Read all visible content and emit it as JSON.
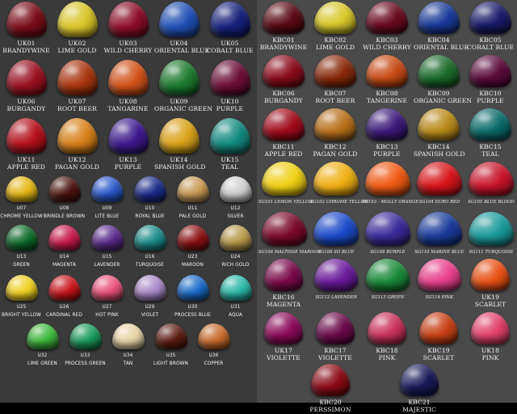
{
  "left_panel": {
    "big_rows": [
      [
        {
          "code": "UK01",
          "name": "BRANDYWINE",
          "color": "#7a0c18"
        },
        {
          "code": "UK02",
          "name": "LIME GOLD",
          "color": "#d9c52a"
        },
        {
          "code": "UK03",
          "name": "WILD CHERRY",
          "color": "#8c0d2a"
        },
        {
          "code": "UK04",
          "name": "ORIENTAL BLUE",
          "color": "#1f4fb3"
        },
        {
          "code": "UK05",
          "name": "COBALT BLUE",
          "color": "#15207a"
        }
      ],
      [
        {
          "code": "UK06",
          "name": "BURGANDY",
          "color": "#9a1020"
        },
        {
          "code": "UK07",
          "name": "ROOT BEER",
          "color": "#a8350f"
        },
        {
          "code": "UK08",
          "name": "TANGARINE",
          "color": "#d2521a"
        },
        {
          "code": "UK09",
          "name": "ORGANIC GREEN",
          "color": "#1c7a2e"
        },
        {
          "code": "UK10",
          "name": "PURPLE",
          "color": "#6a0e35"
        }
      ],
      [
        {
          "code": "UK11",
          "name": "APPLE RED",
          "color": "#b5101c"
        },
        {
          "code": "UK12",
          "name": "PAGAN GOLD",
          "color": "#d7811a"
        },
        {
          "code": "UK13",
          "name": "PURPLE",
          "color": "#3c1a8e"
        },
        {
          "code": "UK14",
          "name": "SPANISH GOLD",
          "color": "#d9a21a"
        },
        {
          "code": "UK15",
          "name": "TEAL",
          "color": "#138a80"
        }
      ]
    ],
    "small_rows": [
      [
        {
          "code": "U07",
          "name": "CHROME YELLOW",
          "color": "#e6b814"
        },
        {
          "code": "U08",
          "name": "BRINDLE BROWN",
          "color": "#4a1410"
        },
        {
          "code": "U09",
          "name": "LITE BLUE",
          "color": "#2a56c8"
        },
        {
          "code": "U10",
          "name": "ROYAL BLUE",
          "color": "#1a2a8a"
        },
        {
          "code": "U11",
          "name": "PALE GOLD",
          "color": "#c89a55"
        },
        {
          "code": "U12",
          "name": "SILVER",
          "color": "#cfcfcf"
        }
      ],
      [
        {
          "code": "U13",
          "name": "GREEN",
          "color": "#0e6a2a"
        },
        {
          "code": "U14",
          "name": "MAGENTA",
          "color": "#c8184a"
        },
        {
          "code": "U15",
          "name": "LAVENDER",
          "color": "#5a2a8a"
        },
        {
          "code": "U16",
          "name": "TURQUOISE",
          "color": "#1a8a8a"
        },
        {
          "code": "U23",
          "name": "MAROON",
          "color": "#8a1010"
        },
        {
          "code": "U24",
          "name": "RICH GOLD",
          "color": "#b89a4a"
        }
      ],
      [
        {
          "code": "U25",
          "name": "BRIGHT YELLOW",
          "color": "#f0d020"
        },
        {
          "code": "U26",
          "name": "CARDINAL RED",
          "color": "#c8141a"
        },
        {
          "code": "U27",
          "name": "HOT PINK",
          "color": "#e8507a"
        },
        {
          "code": "U29",
          "name": "VIOLET",
          "color": "#a88ac8"
        },
        {
          "code": "U30",
          "name": "PROCESS BLUE",
          "color": "#1a6ac8"
        },
        {
          "code": "U31",
          "name": "AQUA",
          "color": "#2ab8a8"
        }
      ],
      [
        {
          "code": "U32",
          "name": "LIME GREEN",
          "color": "#3ab83a"
        },
        {
          "code": "U33",
          "name": "PROCESS GREEN",
          "color": "#1a9a5a"
        },
        {
          "code": "U34",
          "name": "TAN",
          "color": "#e8d4a8"
        },
        {
          "code": "U35",
          "name": "LIGHT BROWN",
          "color": "#5a1a10"
        },
        {
          "code": "U36",
          "name": "COPPER",
          "color": "#c86a2a"
        }
      ]
    ]
  },
  "right_panel": {
    "big_rows": [
      [
        {
          "code": "KBC01",
          "name": "BRANDYWINE",
          "color": "#5a0a14"
        },
        {
          "code": "KBC02",
          "name": "LIME GOLD",
          "color": "#d8c82a"
        },
        {
          "code": "KBC03",
          "name": "WILD CHERRY",
          "color": "#6a0a20"
        },
        {
          "code": "KBC04",
          "name": "ORIENTAL BLUE",
          "color": "#1a3a9a"
        },
        {
          "code": "KBC05",
          "name": "COBALT BLUE",
          "color": "#1a1a6a"
        }
      ],
      [
        {
          "code": "KBC06",
          "name": "BURGANDY",
          "color": "#8a0a1a"
        },
        {
          "code": "KBC07",
          "name": "ROOT BEER",
          "color": "#8a2a0a"
        },
        {
          "code": "KBC08",
          "name": "TANGERINE",
          "color": "#c84a14"
        },
        {
          "code": "KBC09",
          "name": "ORGANIC GREEN",
          "color": "#1a6a2a"
        },
        {
          "code": "KBC10",
          "name": "PURPLE",
          "color": "#5a0a3a"
        }
      ],
      [
        {
          "code": "KBC11",
          "name": "APPLE RED",
          "color": "#a00a1a"
        },
        {
          "code": "KBC12",
          "name": "PAGAN GOLD",
          "color": "#b8701a"
        },
        {
          "code": "KBC13",
          "name": "PURPLE",
          "color": "#3a1a7a"
        },
        {
          "code": "KBC14",
          "name": "SPANISH GOLD",
          "color": "#b88a1a"
        },
        {
          "code": "KBC15",
          "name": "TEAL",
          "color": "#0a6a6a"
        }
      ]
    ],
    "sg_rows": [
      [
        {
          "name": "SG101 LEMON YELLOW",
          "color": "#f0d014"
        },
        {
          "name": "SG102 CHROME YELLOW",
          "color": "#f0b014"
        },
        {
          "name": "SG103 - MOLLY ORANGE",
          "color": "#f05a14"
        },
        {
          "name": "SG104 EURO RED",
          "color": "#d8141a"
        },
        {
          "name": "SG105 BLUE BLOOD",
          "color": "#c8142a"
        }
      ],
      [
        {
          "name": "SG106 MALTISSE MAROON",
          "color": "#7a0a2a"
        },
        {
          "name": "SG108 SO BLUE",
          "color": "#1a4ac8"
        },
        {
          "name": "SG109 BURPLE",
          "color": "#3a2a9a"
        },
        {
          "name": "SG110 MARINE BLUE",
          "color": "#1a3a9a"
        },
        {
          "name": "SG111 TURQUOISE",
          "color": "#1a9a9a"
        }
      ]
    ],
    "mixed_rows": [
      [
        {
          "code": "KBC16",
          "name": "MAGENTA",
          "color": "#7a0a4a",
          "kind": "big"
        },
        {
          "name": "SG112 LAVENDER",
          "color": "#6a1a9a",
          "kind": "sg"
        },
        {
          "name": "SG113 GREEN",
          "color": "#1a8a3a",
          "kind": "sg"
        },
        {
          "name": "SG114 PINK",
          "color": "#e8408a",
          "kind": "sg"
        },
        {
          "code": "UK19",
          "name": "SCARLET",
          "color": "#e85014",
          "kind": "big"
        }
      ],
      [
        {
          "code": "UK17",
          "name": "VIOLETTE",
          "color": "#8a0a5a",
          "kind": "big"
        },
        {
          "code": "KBC17",
          "name": "VIOLETTE",
          "color": "#6a0a4a",
          "kind": "big"
        },
        {
          "code": "KBC18",
          "name": "PINK",
          "color": "#c8305a",
          "kind": "big"
        },
        {
          "code": "KBC19",
          "name": "SCARLET",
          "color": "#c84014",
          "kind": "big"
        },
        {
          "code": "UK18",
          "name": "PINK",
          "color": "#e0406a",
          "kind": "big"
        }
      ],
      [
        {
          "code": "KBC20",
          "name": "PERSSIMON",
          "color": "#8a0a14",
          "kind": "big"
        },
        {
          "code": "KBC21",
          "name": "MAJESTIC",
          "color": "#1a1a5a",
          "kind": "big"
        }
      ]
    ]
  }
}
